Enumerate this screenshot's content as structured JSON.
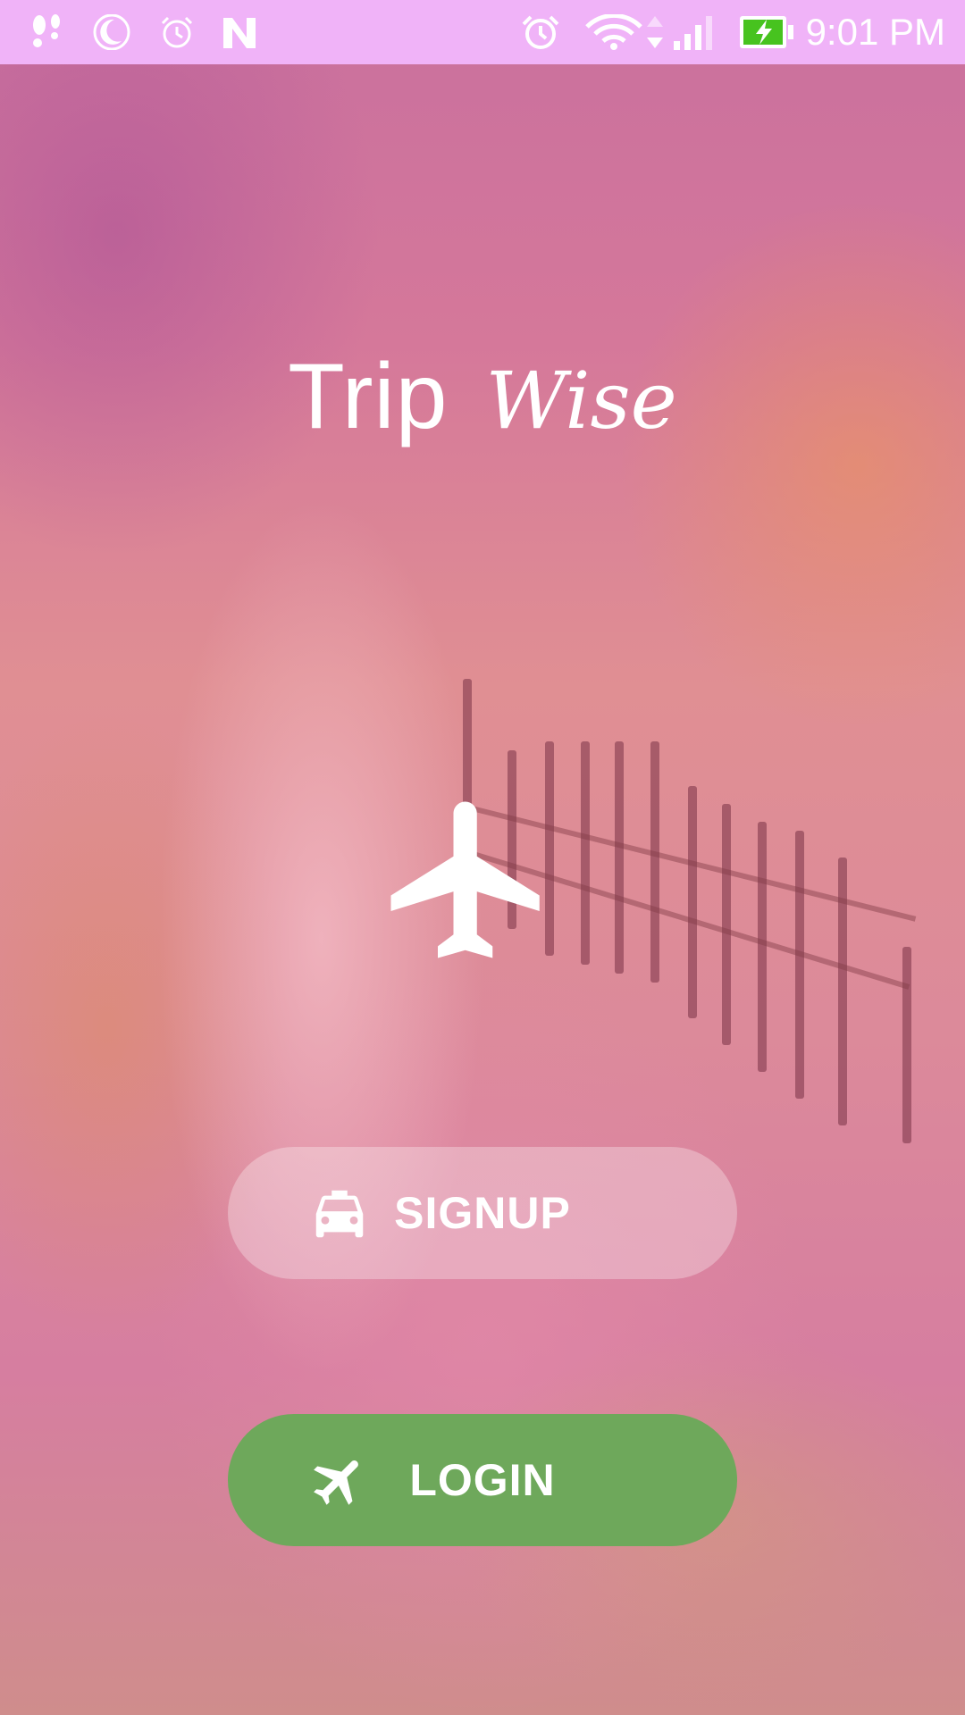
{
  "status_bar": {
    "time": "9:01 PM",
    "icons": [
      "notification-footprints-icon",
      "night-mode-icon",
      "alarm-small-icon",
      "n-app-icon",
      "alarm-icon",
      "wifi-icon",
      "data-arrows-icon",
      "signal-icon",
      "battery-charging-icon"
    ],
    "battery_color": "#47c31f"
  },
  "app": {
    "title_part1": "Trip",
    "title_part2": "Wise",
    "hero_icon": "airplane-icon"
  },
  "buttons": {
    "signup": {
      "label": "SIGNUP",
      "icon": "taxi-icon"
    },
    "login": {
      "label": "LOGIN",
      "icon": "flight-takeoff-icon",
      "color": "#6ea85b"
    }
  },
  "colors": {
    "status_bar": "#f0b3f8",
    "text": "#ffffff"
  }
}
